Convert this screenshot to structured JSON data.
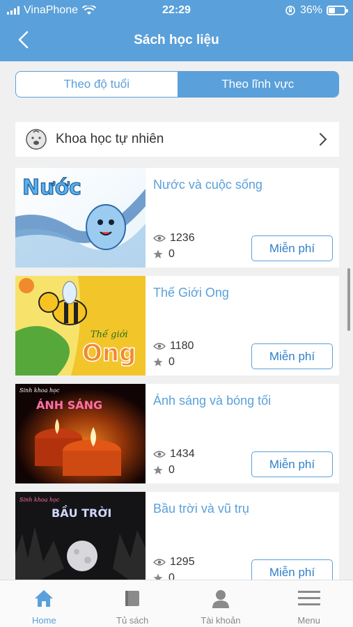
{
  "status_bar": {
    "carrier": "VinaPhone",
    "time": "22:29",
    "battery": "36%",
    "battery_level": 0.36
  },
  "header": {
    "title": "Sách học liệu",
    "back_icon": "chevron-left-icon"
  },
  "segments": [
    {
      "label": "Theo độ tuổi",
      "active": false
    },
    {
      "label": "Theo lĩnh vực",
      "active": true
    }
  ],
  "category": {
    "label": "Khoa học tự nhiên",
    "icon": "baby-face-icon"
  },
  "books": [
    {
      "title": "Nước và cuộc sống",
      "views": "1236",
      "stars": "0",
      "button": "Miễn phí",
      "cover_text": "Nước"
    },
    {
      "title": "Thế Giới Ong",
      "views": "1180",
      "stars": "0",
      "button": "Miễn phí",
      "cover_text": "Ong",
      "cover_text_small": "Thế giới"
    },
    {
      "title": "Ánh sáng và bóng tối",
      "views": "1434",
      "stars": "0",
      "button": "Miễn phí",
      "cover_text": "ÁNH SÁNG",
      "cover_text_small": "Sinh khoa học"
    },
    {
      "title": "Bầu trời và vũ trụ",
      "views": "1295",
      "stars": "0",
      "button": "Miễn phí",
      "cover_text": "BẦU TRỜI",
      "cover_text_small": "Sinh khoa học"
    }
  ],
  "tabs": [
    {
      "label": "Home",
      "icon": "home-icon",
      "active": true
    },
    {
      "label": "Tủ sách",
      "icon": "book-icon",
      "active": false
    },
    {
      "label": "Tài khoản",
      "icon": "user-icon",
      "active": false
    },
    {
      "label": "Menu",
      "icon": "menu-icon",
      "active": false
    }
  ],
  "colors": {
    "primary": "#5aa0da",
    "button_text": "#2f7fc9",
    "background": "#f0f0f0"
  }
}
